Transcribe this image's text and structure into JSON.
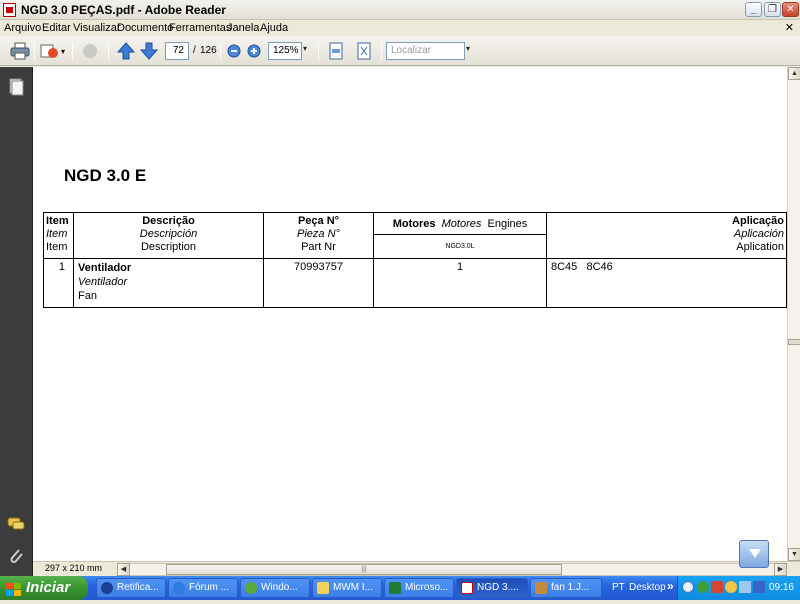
{
  "window": {
    "title": "NGD 3.0 PEÇAS.pdf - Adobe Reader"
  },
  "menu": [
    "Arquivo",
    "Editar",
    "Visualizar",
    "Documento",
    "Ferramentas",
    "Janela",
    "Ajuda"
  ],
  "toolbar": {
    "current_page": "72",
    "page_separator": "/",
    "total_pages": "126",
    "zoom": "125%",
    "search_placeholder": "Localizar"
  },
  "document": {
    "heading": "NGD 3.0 E",
    "headers": {
      "item": [
        "Item",
        "Item",
        "Item"
      ],
      "descricao": [
        "Descrição",
        "Descripción",
        "Description"
      ],
      "peca": [
        "Peça N°",
        "Pieza N°",
        "Part Nr"
      ],
      "motores": [
        "Motores",
        "Motores",
        "Engines"
      ],
      "motores_sub": "NGD3.0L",
      "aplicacao": [
        "Aplicação",
        "Aplicación",
        "Aplication"
      ]
    },
    "rows": [
      {
        "item": "1",
        "descricao": [
          "Ventilador",
          "Ventilador",
          "Fan"
        ],
        "peca": "70993757",
        "qty": "1",
        "aplicacao": "8C45   8C46"
      }
    ]
  },
  "status": {
    "page_size": "297 x 210 mm"
  },
  "taskbar": {
    "start": "Iniciar",
    "tasks": [
      "Retifica...",
      "Fórum ...",
      "Windo...",
      "MWM I...",
      "Microso...",
      "NGD 3....",
      "fan 1.J..."
    ],
    "lang": "PT",
    "desktop": "Desktop",
    "clock": "09:16"
  }
}
